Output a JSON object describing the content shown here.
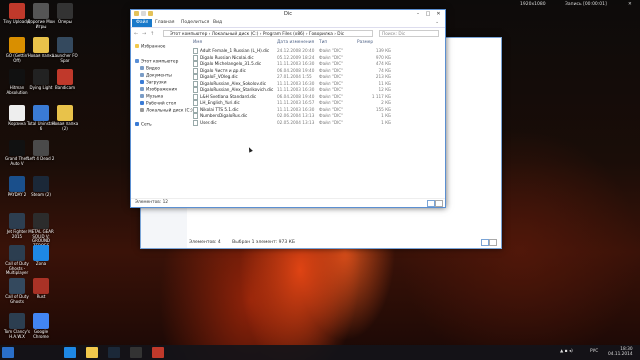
{
  "topbar": {
    "resolution": "1920x1080",
    "recording": "Запись [00:00:01]"
  },
  "desktop_icons": [
    {
      "label": "Tiny Uploader",
      "color": "#c0392b"
    },
    {
      "label": "Дорогие Мои Игры",
      "color": "#555"
    },
    {
      "label": "Оперы",
      "color": "#333"
    },
    {
      "label": "GO (Gettin' Off)",
      "color": "#d98f00"
    },
    {
      "label": "Новая папка",
      "color": "#e8c24a"
    },
    {
      "label": "Launcher FO Spar",
      "color": "#34495e"
    },
    {
      "label": "Hitman Absolution",
      "color": "#111"
    },
    {
      "label": "Dying Light",
      "color": "#222"
    },
    {
      "label": "Bandicam",
      "color": "#c0392b"
    },
    {
      "label": "Корзина",
      "color": "#eee"
    },
    {
      "label": "Total Uninstall 6",
      "color": "#3a7bd5"
    },
    {
      "label": "Новая папка (2)",
      "color": "#e8c24a"
    },
    {
      "label": "Grand Theft Auto V",
      "color": "#111"
    },
    {
      "label": "Left 4 Dead 2",
      "color": "#4a4a4a"
    },
    {
      "label": "PAYDAY 2",
      "color": "#1a4f8b"
    },
    {
      "label": "Steam (2)",
      "color": "#1b2838"
    },
    {
      "label": "Jet Fighter 2015",
      "color": "#2d3e50"
    },
    {
      "label": "METAL GEAR SOLID V: GROUND ZEROES",
      "color": "#2c2c2c"
    },
    {
      "label": "Call of Duty Ghosts - Multiplayer",
      "color": "#2c3e50"
    },
    {
      "label": "Zona",
      "color": "#1e88e5"
    },
    {
      "label": "Call of Duty Ghosts",
      "color": "#34495e"
    },
    {
      "label": "Rust",
      "color": "#a93226"
    },
    {
      "label": "Tom Clancy's H.A.W.X",
      "color": "#2c3e50"
    },
    {
      "label": "Google Chrome",
      "color": "#4285f4"
    }
  ],
  "window_back": {
    "status_items": "Элементов: 4",
    "status_selected": "Выбран 1 элемент: 973 КБ"
  },
  "window": {
    "title": "Dic",
    "ribbon_tabs": [
      "Файл",
      "Главная",
      "Поделиться",
      "Вид"
    ],
    "address_path": "Этот компьютер › Локальный диск (C:) › Program Files (x86) › Говорилка › Dic",
    "search_placeholder": "Поиск: Dic",
    "columns": {
      "name": "Имя",
      "date": "Дата изменения",
      "type": "Тип",
      "size": "Размер"
    },
    "nav_pane": [
      {
        "label": "Избранное",
        "icon": "star-icon",
        "color": "#f2c94c"
      },
      {
        "label": "Этот компьютер",
        "icon": "computer-icon",
        "color": "#5a8fd6"
      },
      {
        "label": "Видео",
        "icon": "video-icon",
        "color": "#7a9cc6"
      },
      {
        "label": "Документы",
        "icon": "document-icon",
        "color": "#7a9cc6"
      },
      {
        "label": "Загрузки",
        "icon": "download-icon",
        "color": "#3a7bd5"
      },
      {
        "label": "Изображения",
        "icon": "image-icon",
        "color": "#7a9cc6"
      },
      {
        "label": "Музыка",
        "icon": "music-icon",
        "color": "#7a9cc6"
      },
      {
        "label": "Рабочий стол",
        "icon": "desktop-icon",
        "color": "#3a7bd5"
      },
      {
        "label": "Локальный диск (C:)",
        "icon": "disk-icon",
        "color": "#999"
      },
      {
        "label": "Сеть",
        "icon": "network-icon",
        "color": "#3a7bd5"
      }
    ],
    "files": [
      {
        "name": "Adult Female_1 Russian (L_H).dic",
        "date": "24.12.2008 20:40",
        "type": "Файл \"DIC\"",
        "size": "139 КБ"
      },
      {
        "name": "Digalo Russian Nicolai.dic",
        "date": "05.12.2009 18:24",
        "type": "Файл \"DIC\"",
        "size": "970 КБ"
      },
      {
        "name": "Digalo Michelangelo_31.5.dic",
        "date": "11.11.2003 16:30",
        "type": "Файл \"DIC\"",
        "size": "474 КБ"
      },
      {
        "name": "Digalo Чистя и др.dic",
        "date": "06.04.2008 19:40",
        "type": "Файл \"DIC\"",
        "size": "74 КБ"
      },
      {
        "name": "DigaloF_VOleg.dic",
        "date": "27.01.2004 1:55",
        "type": "Файл \"DIC\"",
        "size": "213 КБ"
      },
      {
        "name": "DigaloRussian_Alex_Sokolov.dic",
        "date": "11.11.2003 16:30",
        "type": "Файл \"DIC\"",
        "size": "11 КБ"
      },
      {
        "name": "DigaloRussian_Alex_Starikovich.dic",
        "date": "11.11.2003 16:30",
        "type": "Файл \"DIC\"",
        "size": "12 КБ"
      },
      {
        "name": "L&H Svetlana Standard.dic",
        "date": "06.04.2008 19:40",
        "type": "Файл \"DIC\"",
        "size": "1 117 КБ"
      },
      {
        "name": "LH_English_Yuri.dic",
        "date": "11.11.2003 16:57",
        "type": "Файл \"DIC\"",
        "size": "2 КБ"
      },
      {
        "name": "Nikolai TTS 5.1.dic",
        "date": "11.11.2003 16:30",
        "type": "Файл \"DIC\"",
        "size": "155 КБ"
      },
      {
        "name": "NumbersDigaloRus.dic",
        "date": "02.06.2004 13:13",
        "type": "Файл \"DIC\"",
        "size": "1 КБ"
      },
      {
        "name": "User.dic",
        "date": "02.05.2004 13:13",
        "type": "Файл \"DIC\"",
        "size": "1 КБ"
      }
    ],
    "status": "Элементов: 12"
  },
  "taskbar": {
    "apps": [
      {
        "name": "start-button",
        "color": "#2a6fc9"
      },
      {
        "name": "ie-taskbar-icon",
        "color": "#1e88e5"
      },
      {
        "name": "explorer-taskbar-icon",
        "color": "#f2c94c"
      },
      {
        "name": "steam-taskbar-icon",
        "color": "#1b2838"
      },
      {
        "name": "monitor-taskbar-icon",
        "color": "#333"
      },
      {
        "name": "bandicam-taskbar-icon",
        "color": "#c0392b"
      }
    ],
    "lang": "РУС",
    "time": "18:30",
    "date": "04.11.2014"
  }
}
